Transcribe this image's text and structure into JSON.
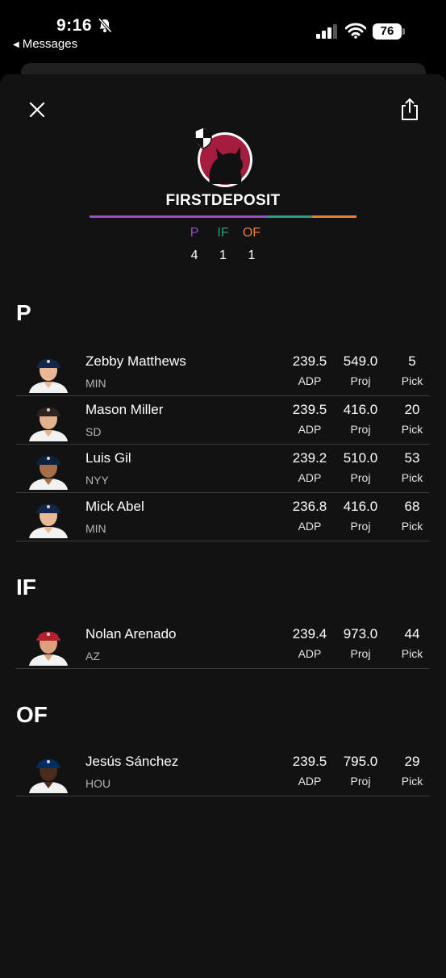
{
  "status_bar": {
    "time": "9:16",
    "back_label": "Messages",
    "battery": "76"
  },
  "team": {
    "name": "FIRSTDEPOSIT",
    "logo_icon": "cat-silhouette-logo-icon",
    "logo_color": "#a51d3e",
    "position_bar": [
      {
        "pos": "P",
        "fraction": 0.667,
        "color": "#9b4dca"
      },
      {
        "pos": "IF",
        "fraction": 0.167,
        "color": "#2a9d7a"
      },
      {
        "pos": "OF",
        "fraction": 0.167,
        "color": "#e6822f"
      }
    ],
    "counts": [
      {
        "label": "P",
        "count": "4",
        "color": "#9b4dca"
      },
      {
        "label": "IF",
        "count": "1",
        "color": "#2a9d7a"
      },
      {
        "label": "OF",
        "count": "1",
        "color": "#e6822f"
      }
    ]
  },
  "stat_labels": {
    "adp": "ADP",
    "proj": "Proj",
    "pick": "Pick"
  },
  "sections": [
    {
      "title": "P",
      "players": [
        {
          "name": "Zebby Matthews",
          "team": "MIN",
          "adp": "239.5",
          "proj": "549.0",
          "pick": "5"
        },
        {
          "name": "Mason Miller",
          "team": "SD",
          "adp": "239.5",
          "proj": "416.0",
          "pick": "20"
        },
        {
          "name": "Luis Gil",
          "team": "NYY",
          "adp": "239.2",
          "proj": "510.0",
          "pick": "53"
        },
        {
          "name": "Mick Abel",
          "team": "MIN",
          "adp": "236.8",
          "proj": "416.0",
          "pick": "68"
        }
      ]
    },
    {
      "title": "IF",
      "players": [
        {
          "name": "Nolan Arenado",
          "team": "AZ",
          "adp": "239.4",
          "proj": "973.0",
          "pick": "44"
        }
      ]
    },
    {
      "title": "OF",
      "players": [
        {
          "name": "Jesús Sánchez",
          "team": "HOU",
          "adp": "239.5",
          "proj": "795.0",
          "pick": "29"
        }
      ]
    }
  ]
}
